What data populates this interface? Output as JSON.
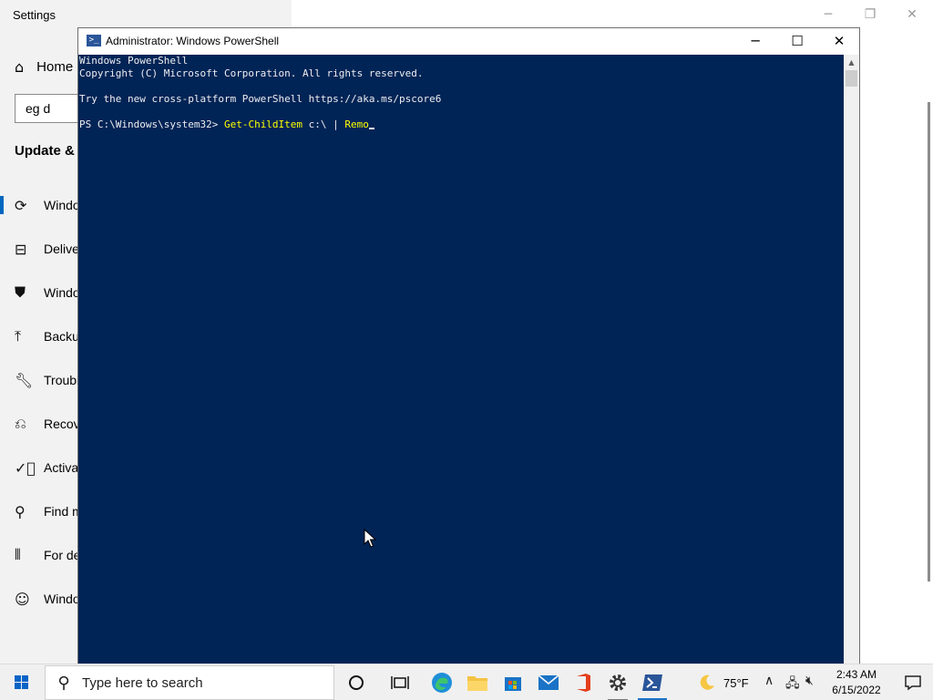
{
  "settings": {
    "title": "Settings",
    "home_label": "Home",
    "search_value": "eg d",
    "section_heading": "Update & S",
    "nav_items": [
      {
        "label": "Windo",
        "icon": "sync-icon"
      },
      {
        "label": "Delive",
        "icon": "delivery-optimization-icon"
      },
      {
        "label": "Windo",
        "icon": "shield-icon"
      },
      {
        "label": "Backup",
        "icon": "backup-arrow-icon"
      },
      {
        "label": "Troubl",
        "icon": "wrench-icon"
      },
      {
        "label": "Recove",
        "icon": "recovery-icon"
      },
      {
        "label": "Activa",
        "icon": "check-circle-icon"
      },
      {
        "label": "Find m",
        "icon": "person-pin-icon"
      },
      {
        "label": "For de",
        "icon": "developer-icon"
      },
      {
        "label": "Windo",
        "icon": "insider-cat-icon"
      }
    ]
  },
  "powershell": {
    "title": "Administrator: Windows PowerShell",
    "lines": [
      "Windows PowerShell",
      "Copyright (C) Microsoft Corporation. All rights reserved.",
      "",
      "Try the new cross-platform PowerShell https://aka.ms/pscore6",
      ""
    ],
    "prompt": "PS C:\\Windows\\system32> ",
    "command": "Get-ChildItem",
    "argument": " c:\\ | ",
    "piped_command": "Remo"
  },
  "taskbar": {
    "search_placeholder": "Type here to search",
    "apps": [
      "cortana-icon",
      "task-view-icon",
      "edge-icon",
      "file-explorer-icon",
      "store-icon",
      "mail-icon",
      "office-icon",
      "settings-icon",
      "powershell-icon"
    ],
    "weather_temp": "75°F",
    "time": "2:43 AM",
    "date": "6/15/2022"
  },
  "colors": {
    "console_bg": "#012456",
    "console_text": "#eeedf0",
    "command_yellow": "#ffff00",
    "accent": "#0067c0"
  }
}
